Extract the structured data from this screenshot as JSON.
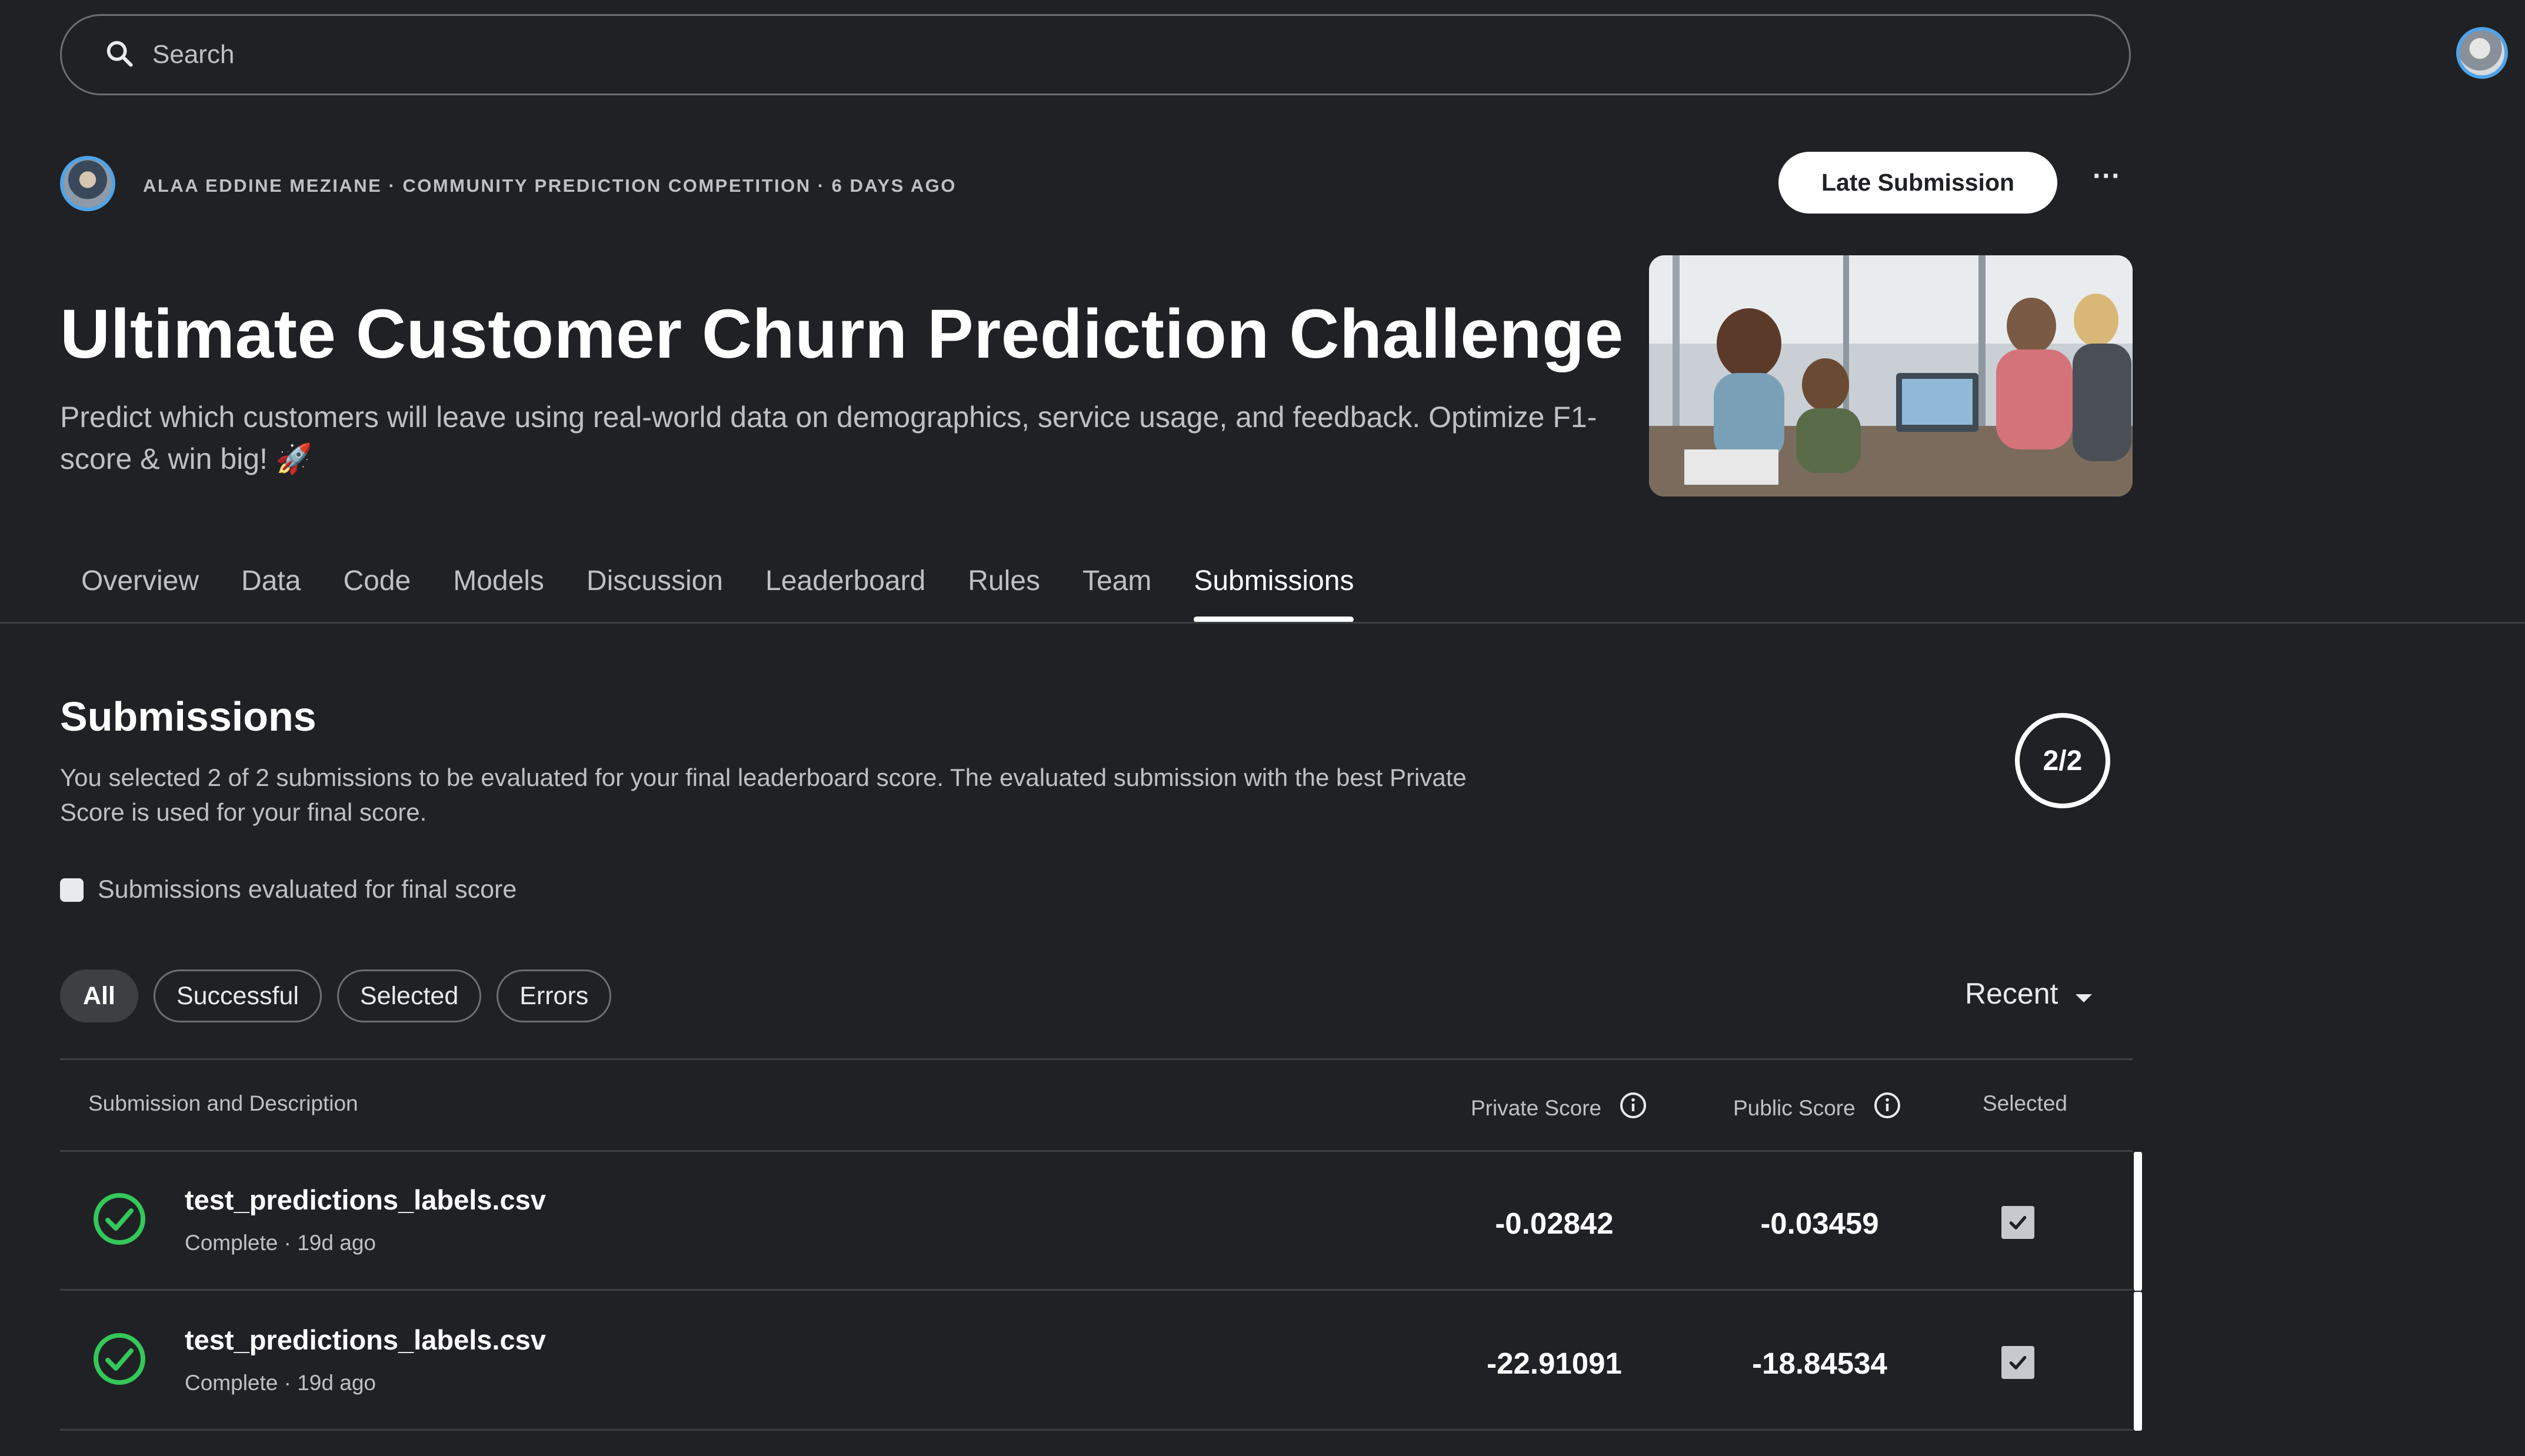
{
  "search": {
    "placeholder": "Search"
  },
  "competition": {
    "host_line": "ALAA EDDINE MEZIANE · COMMUNITY PREDICTION COMPETITION · 6 DAYS AGO",
    "late_submission_label": "Late Submission",
    "more_label": "···",
    "title": "Ultimate Customer Churn Prediction Challenge",
    "subtitle": "Predict which customers will leave using real-world data on demographics, service usage, and feedback. Optimize F1-score & win big! 🚀"
  },
  "tabs": [
    {
      "label": "Overview"
    },
    {
      "label": "Data"
    },
    {
      "label": "Code"
    },
    {
      "label": "Models"
    },
    {
      "label": "Discussion"
    },
    {
      "label": "Leaderboard"
    },
    {
      "label": "Rules"
    },
    {
      "label": "Team"
    },
    {
      "label": "Submissions",
      "active": true
    }
  ],
  "submissions": {
    "title": "Submissions",
    "description": "You selected 2 of 2 submissions to be evaluated for your final leaderboard score. The evaluated submission with the best Private Score is used for your final score.",
    "counter": "2/2",
    "legend_label": "Submissions evaluated for final score",
    "filters": [
      {
        "label": "All",
        "active": true
      },
      {
        "label": "Successful"
      },
      {
        "label": "Selected"
      },
      {
        "label": "Errors"
      }
    ],
    "sort_label": "Recent",
    "columns": {
      "submission": "Submission and Description",
      "private": "Private Score",
      "public": "Public Score",
      "selected": "Selected"
    },
    "rows": [
      {
        "filename": "test_predictions_labels.csv",
        "status": "Complete · 19d ago",
        "private_score": "-0.02842",
        "public_score": "-0.03459",
        "selected": true
      },
      {
        "filename": "test_predictions_labels.csv",
        "status": "Complete · 19d ago",
        "private_score": "-22.91091",
        "public_score": "-18.84534",
        "selected": true
      }
    ]
  },
  "colors": {
    "background": "#202124",
    "success_green": "#34c759",
    "avatar_ring": "#4fa3e8"
  }
}
